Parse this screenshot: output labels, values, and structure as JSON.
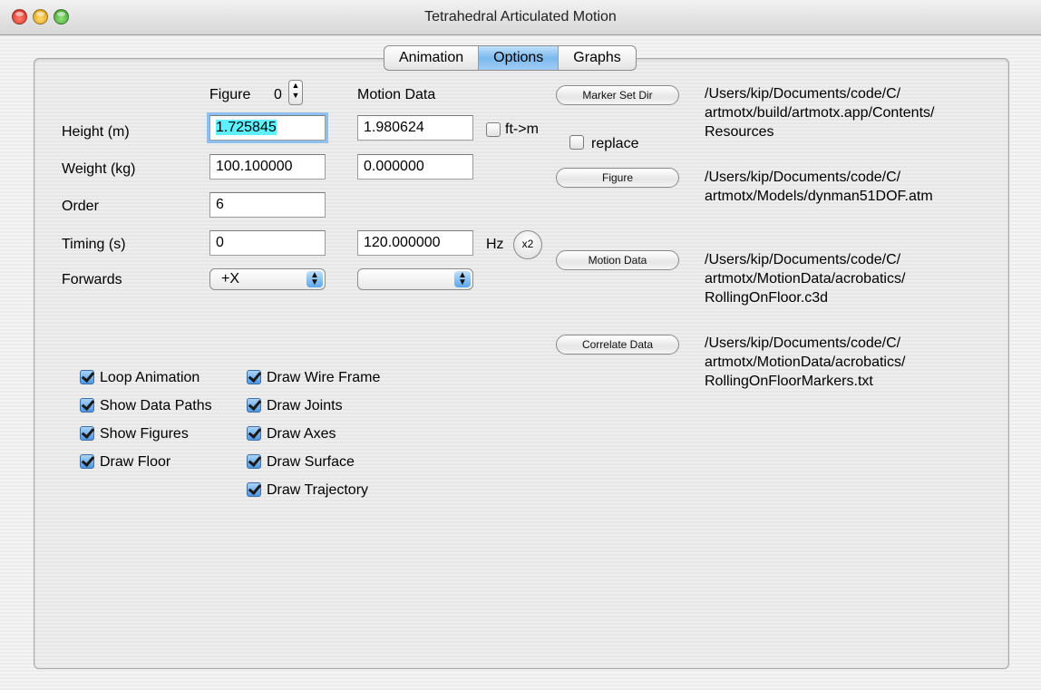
{
  "window": {
    "title": "Tetrahedral Articulated Motion"
  },
  "tabs": [
    {
      "label": "Animation"
    },
    {
      "label": "Options"
    },
    {
      "label": "Graphs"
    }
  ],
  "headers": {
    "figure": "Figure",
    "figure_index": "0",
    "motion_data": "Motion Data"
  },
  "rows": {
    "height": {
      "label": "Height (m)",
      "figure_value": "1.725845",
      "motion_value": "1.980624"
    },
    "weight": {
      "label": "Weight (kg)",
      "figure_value": "100.100000",
      "motion_value": "0.000000"
    },
    "order": {
      "label": "Order",
      "figure_value": "6"
    },
    "timing": {
      "label": "Timing (s)",
      "figure_value": "0",
      "motion_value": "120.000000",
      "unit": "Hz",
      "double_label": "x2"
    },
    "forwards": {
      "label": "Forwards",
      "figure_value": "+X",
      "motion_value": ""
    }
  },
  "ft_to_m": {
    "label": "ft->m",
    "checked": false
  },
  "replace": {
    "label": "replace",
    "checked": false
  },
  "buttons": {
    "marker_set_dir": "Marker Set Dir",
    "figure": "Figure",
    "motion_data": "Motion Data",
    "correlate_data": "Correlate Data"
  },
  "paths": {
    "marker_set_dir": "/Users/kip/Documents/code/C/ artmotx/build/artmotx.app/Contents/ Resources",
    "figure": "/Users/kip/Documents/code/C/ artmotx/Models/dynman51DOF.atm",
    "motion_data": "/Users/kip/Documents/code/C/ artmotx/MotionData/acrobatics/ RollingOnFloor.c3d",
    "correlate_data": "/Users/kip/Documents/code/C/ artmotx/MotionData/acrobatics/ RollingOnFloorMarkers.txt"
  },
  "options_left": [
    {
      "label": "Loop Animation",
      "checked": true
    },
    {
      "label": "Show Data Paths",
      "checked": true
    },
    {
      "label": "Show Figures",
      "checked": true
    },
    {
      "label": "Draw Floor",
      "checked": true
    }
  ],
  "options_right": [
    {
      "label": "Draw Wire Frame",
      "checked": true
    },
    {
      "label": "Draw Joints",
      "checked": true
    },
    {
      "label": "Draw Axes",
      "checked": true
    },
    {
      "label": "Draw Surface",
      "checked": true
    },
    {
      "label": "Draw Trajectory",
      "checked": true
    }
  ],
  "colors": {
    "accent": "#5da5ea",
    "selection": "#5ef0ff",
    "tab_active": "#7cb9ee"
  }
}
